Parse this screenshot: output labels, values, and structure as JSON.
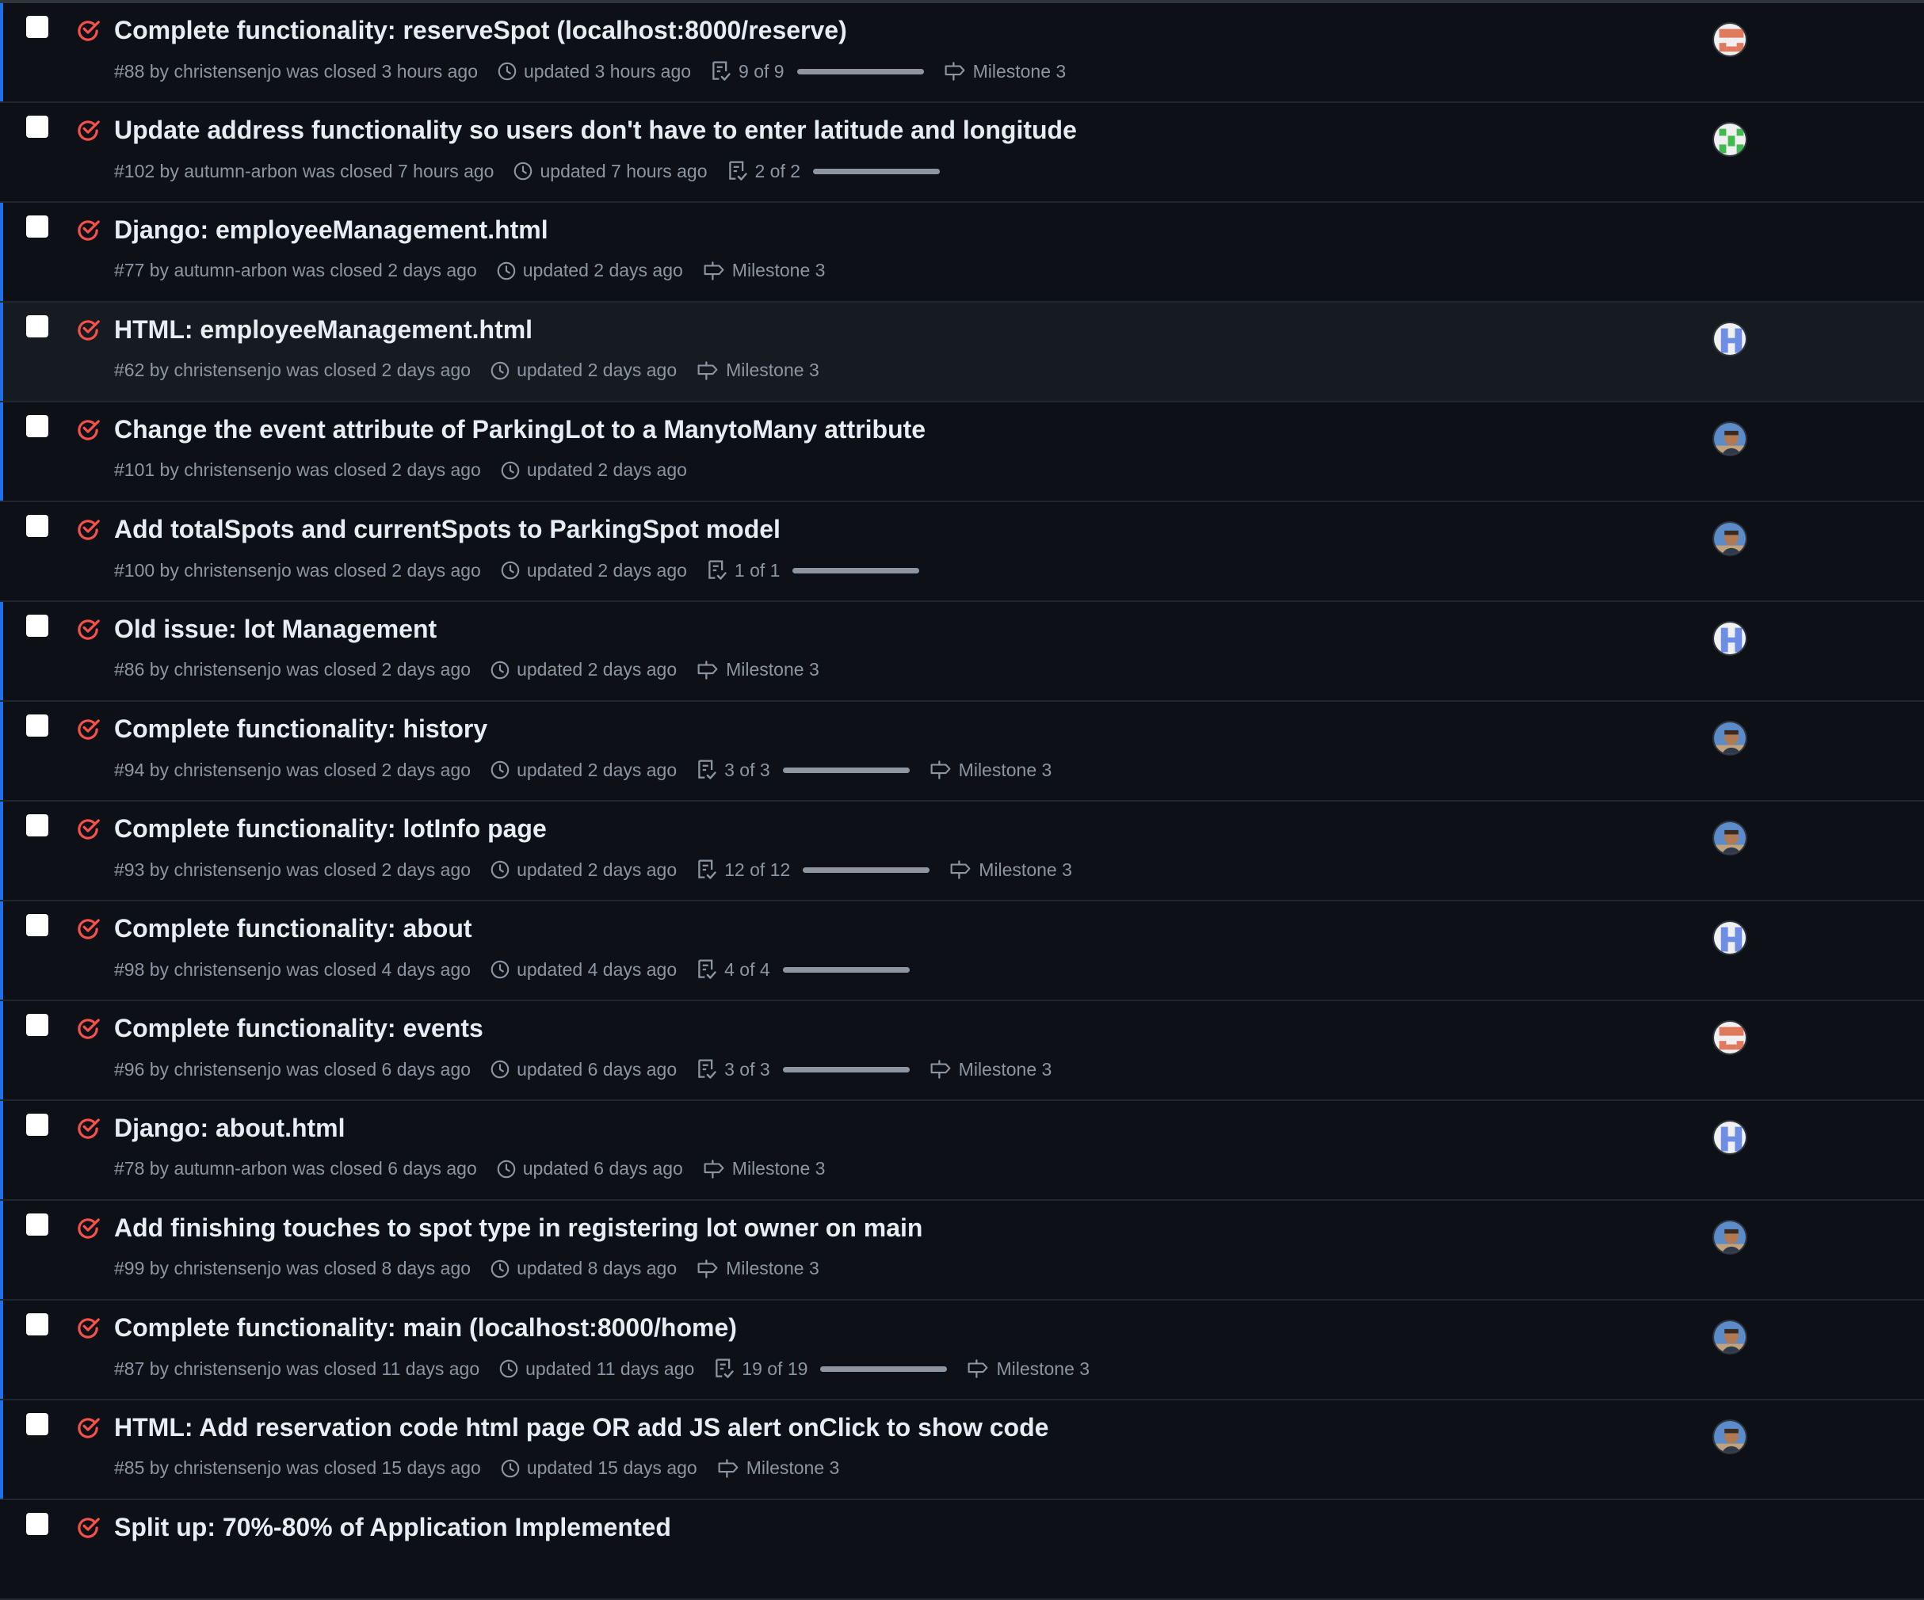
{
  "issues": [
    {
      "title": "Complete functionality: reserveSpot (localhost:8000/reserve)",
      "meta": "#88 by christensenjo was closed 3 hours ago",
      "updated": "updated 3 hours ago",
      "tasks": "9 of 9",
      "progress": 1.0,
      "milestone": "Milestone 3",
      "avatar": "orange-identicon",
      "unread": true,
      "hover": false
    },
    {
      "title": "Update address functionality so users don't have to enter latitude and longitude",
      "meta": "#102 by autumn-arbon was closed 7 hours ago",
      "updated": "updated 7 hours ago",
      "tasks": "2 of 2",
      "progress": 1.0,
      "milestone": "",
      "avatar": "green-identicon",
      "unread": false,
      "hover": false
    },
    {
      "title": "Django: employeeManagement.html",
      "meta": "#77 by autumn-arbon was closed 2 days ago",
      "updated": "updated 2 days ago",
      "tasks": "",
      "progress": null,
      "milestone": "Milestone 3",
      "avatar": "",
      "unread": true,
      "hover": false
    },
    {
      "title": "HTML: employeeManagement.html",
      "meta": "#62 by christensenjo was closed 2 days ago",
      "updated": "updated 2 days ago",
      "tasks": "",
      "progress": null,
      "milestone": "Milestone 3",
      "avatar": "blue-identicon",
      "unread": true,
      "hover": true
    },
    {
      "title": "Change the event attribute of ParkingLot to a ManytoMany attribute",
      "meta": "#101 by christensenjo was closed 2 days ago",
      "updated": "updated 2 days ago",
      "tasks": "",
      "progress": null,
      "milestone": "",
      "avatar": "photo-avatar",
      "unread": true,
      "hover": false
    },
    {
      "title": "Add totalSpots and currentSpots to ParkingSpot model",
      "meta": "#100 by christensenjo was closed 2 days ago",
      "updated": "updated 2 days ago",
      "tasks": "1 of 1",
      "progress": 1.0,
      "milestone": "",
      "avatar": "photo-avatar",
      "unread": false,
      "hover": false
    },
    {
      "title": "Old issue: lot Management",
      "meta": "#86 by christensenjo was closed 2 days ago",
      "updated": "updated 2 days ago",
      "tasks": "",
      "progress": null,
      "milestone": "Milestone 3",
      "avatar": "blue-identicon",
      "unread": true,
      "hover": false
    },
    {
      "title": "Complete functionality: history",
      "meta": "#94 by christensenjo was closed 2 days ago",
      "updated": "updated 2 days ago",
      "tasks": "3 of 3",
      "progress": 1.0,
      "milestone": "Milestone 3",
      "avatar": "photo-avatar",
      "unread": true,
      "hover": false
    },
    {
      "title": "Complete functionality: lotInfo page",
      "meta": "#93 by christensenjo was closed 2 days ago",
      "updated": "updated 2 days ago",
      "tasks": "12 of 12",
      "progress": 1.0,
      "milestone": "Milestone 3",
      "avatar": "photo-avatar",
      "unread": true,
      "hover": false
    },
    {
      "title": "Complete functionality: about",
      "meta": "#98 by christensenjo was closed 4 days ago",
      "updated": "updated 4 days ago",
      "tasks": "4 of 4",
      "progress": 1.0,
      "milestone": "",
      "avatar": "blue-identicon",
      "unread": true,
      "hover": false
    },
    {
      "title": "Complete functionality: events",
      "meta": "#96 by christensenjo was closed 6 days ago",
      "updated": "updated 6 days ago",
      "tasks": "3 of 3",
      "progress": 1.0,
      "milestone": "Milestone 3",
      "avatar": "orange-identicon",
      "unread": true,
      "hover": false
    },
    {
      "title": "Django: about.html",
      "meta": "#78 by autumn-arbon was closed 6 days ago",
      "updated": "updated 6 days ago",
      "tasks": "",
      "progress": null,
      "milestone": "Milestone 3",
      "avatar": "blue-identicon",
      "unread": true,
      "hover": false
    },
    {
      "title": "Add finishing touches to spot type in registering lot owner on main",
      "meta": "#99 by christensenjo was closed 8 days ago",
      "updated": "updated 8 days ago",
      "tasks": "",
      "progress": null,
      "milestone": "Milestone 3",
      "avatar": "photo-avatar",
      "unread": true,
      "hover": false
    },
    {
      "title": "Complete functionality: main (localhost:8000/home)",
      "meta": "#87 by christensenjo was closed 11 days ago",
      "updated": "updated 11 days ago",
      "tasks": "19 of 19",
      "progress": 1.0,
      "milestone": "Milestone 3",
      "avatar": "photo-avatar",
      "unread": true,
      "hover": false
    },
    {
      "title": "HTML: Add reservation code html page OR add JS alert onClick to show code",
      "meta": "#85 by christensenjo was closed 15 days ago",
      "updated": "updated 15 days ago",
      "tasks": "",
      "progress": null,
      "milestone": "Milestone 3",
      "avatar": "photo-avatar",
      "unread": true,
      "hover": false
    },
    {
      "title": "Split up: 70%-80% of Application Implemented",
      "meta": "",
      "updated": "",
      "tasks": "",
      "progress": null,
      "milestone": "",
      "avatar": "",
      "unread": false,
      "hover": false
    }
  ],
  "colors": {
    "closed_icon": "#f85149",
    "accent_unread": "#1f6feb",
    "text_primary": "#e6edf3",
    "text_muted": "#8d96a0",
    "background": "#0d1117"
  }
}
